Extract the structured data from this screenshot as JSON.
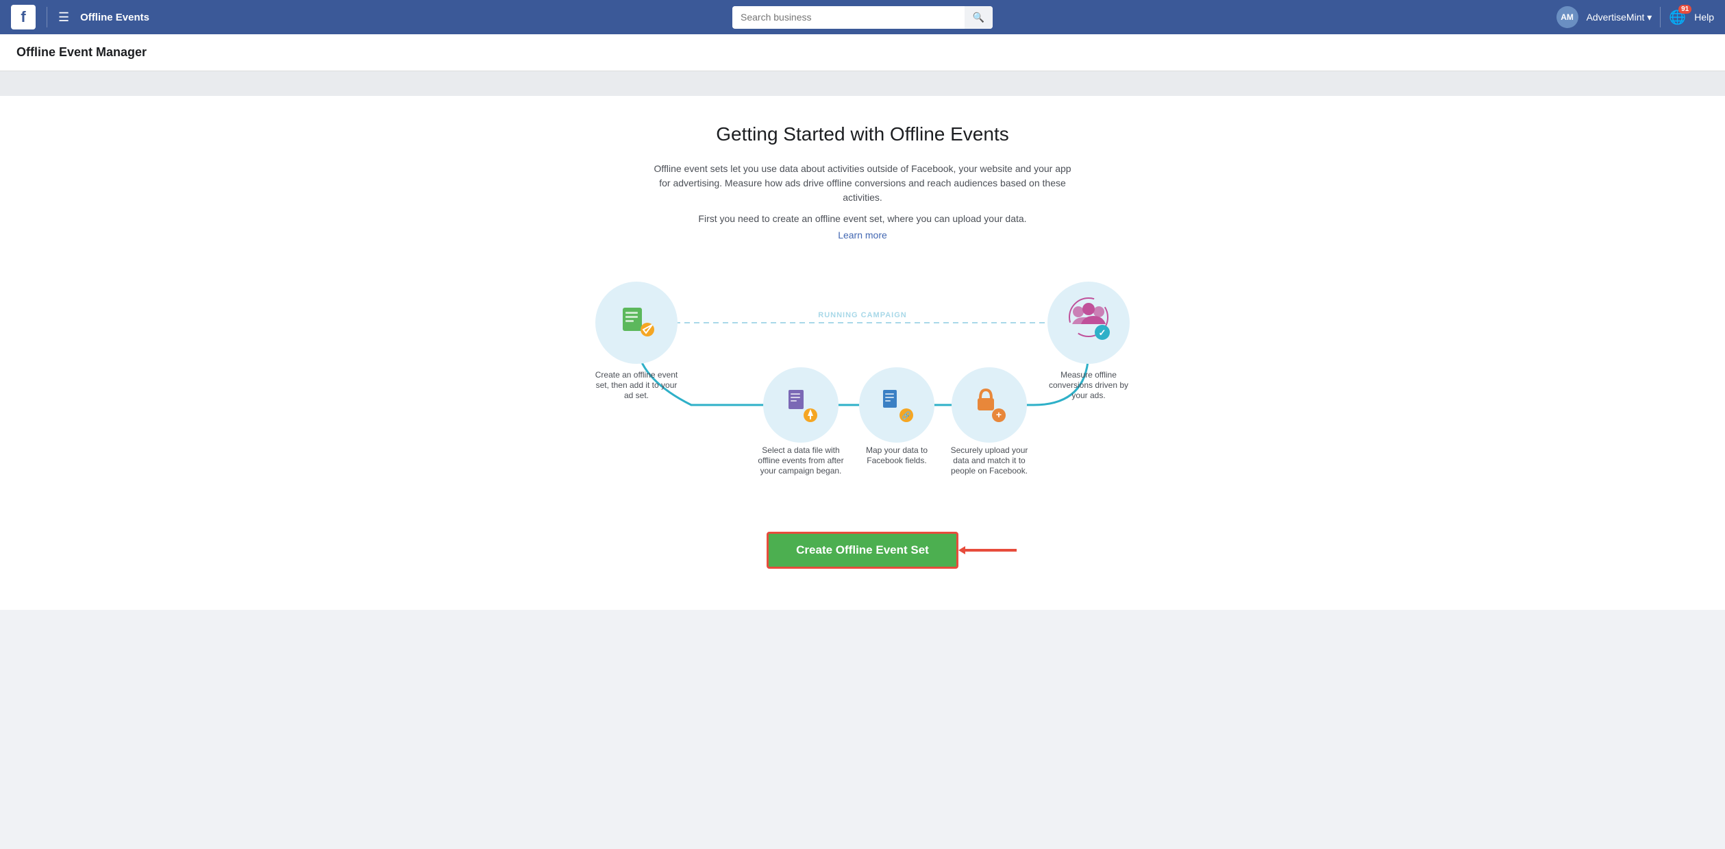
{
  "header": {
    "logo_text": "f",
    "menu_icon": "☰",
    "title": "Offline Events",
    "search_placeholder": "Search business",
    "account_initials": "AM",
    "account_name": "AdvertiseMint",
    "notification_count": "91",
    "help_label": "Help"
  },
  "subheader": {
    "title": "Offline Event Manager"
  },
  "main": {
    "heading": "Getting Started with Offline Events",
    "description1": "Offline event sets let you use data about activities outside of Facebook, your website and your app for advertising. Measure how ads drive offline conversions and reach audiences based on these activities.",
    "description2": "First you need to create an offline event set, where you can upload your data.",
    "learn_more_label": "Learn more",
    "running_campaign_label": "RUNNING CAMPAIGN",
    "steps": [
      {
        "label": "Create an offline event set, then add it to your ad set.",
        "icon_name": "green-doc-icon"
      },
      {
        "label": "Select a data file with offline events from after your campaign began.",
        "icon_name": "purple-upload-icon"
      },
      {
        "label": "Map your data to Facebook fields.",
        "icon_name": "blue-doc-icon"
      },
      {
        "label": "Securely upload your data and match it to people on Facebook.",
        "icon_name": "orange-lock-icon"
      },
      {
        "label": "Measure offline conversions driven by your ads.",
        "icon_name": "pink-audience-icon"
      }
    ],
    "create_button_label": "Create Offline Event Set"
  }
}
